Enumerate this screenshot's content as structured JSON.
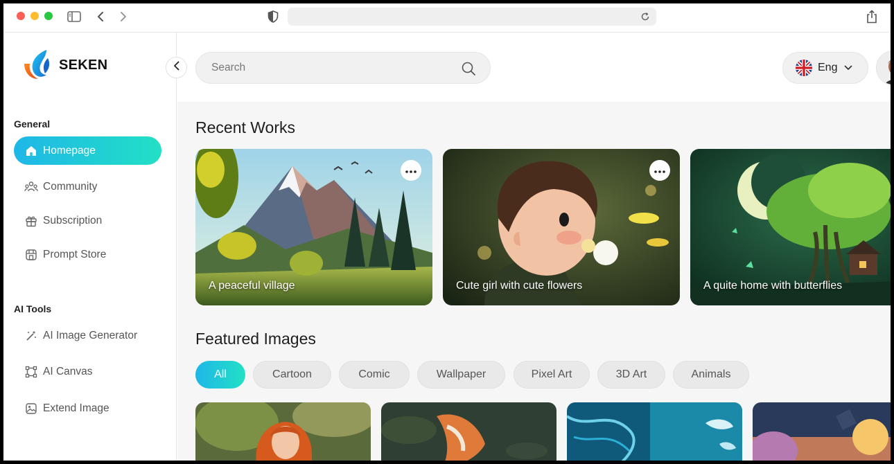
{
  "browser": {
    "icons": [
      "sidebar-toggle-icon",
      "back-icon",
      "forward-icon",
      "shield-icon",
      "reload-icon",
      "share-icon"
    ]
  },
  "brand": {
    "name": "SEKEN"
  },
  "sidebar": {
    "sections": [
      {
        "title": "General",
        "items": [
          {
            "label": "Homepage",
            "icon": "home-icon",
            "active": true
          },
          {
            "label": "Community",
            "icon": "community-icon"
          },
          {
            "label": "Subscription",
            "icon": "gift-icon"
          },
          {
            "label": "Prompt Store",
            "icon": "store-icon"
          }
        ]
      },
      {
        "title": "AI Tools",
        "items": [
          {
            "label": "AI Image Generator",
            "icon": "magic-wand-icon"
          },
          {
            "label": "AI Canvas",
            "icon": "canvas-icon"
          },
          {
            "label": "Extend Image",
            "icon": "image-icon"
          }
        ]
      }
    ]
  },
  "search": {
    "placeholder": "Search"
  },
  "language": {
    "label": "Eng"
  },
  "recent_works": {
    "title": "Recent Works",
    "cards": [
      {
        "caption": "A peaceful  village"
      },
      {
        "caption": "Cute girl with cute flowers"
      },
      {
        "caption": "A quite home with butterflies"
      }
    ]
  },
  "featured": {
    "title": "Featured Images",
    "filters": [
      "All",
      "Cartoon",
      "Comic",
      "Wallpaper",
      "Pixel Art",
      "3D Art",
      "Animals"
    ],
    "active_filter": "All"
  },
  "colors": {
    "accent_start": "#1fb7e7",
    "accent_end": "#22e0c5"
  }
}
